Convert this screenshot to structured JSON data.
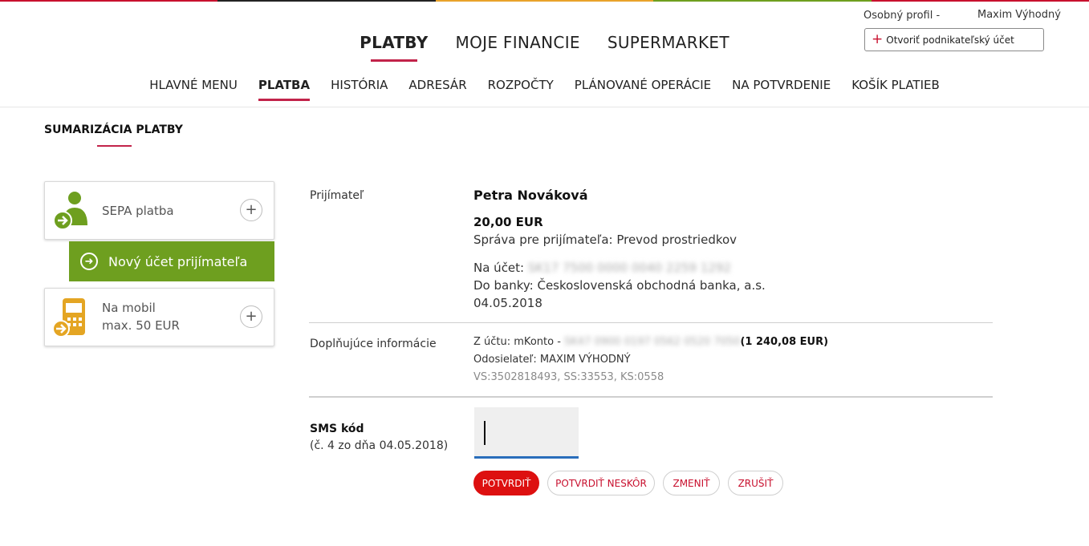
{
  "brand_colors": {
    "accent_red": "#c2234a",
    "action_red": "#dd1010",
    "green": "#6e9f1f",
    "input_focus_blue": "#2a6ebb"
  },
  "top_stripe_colors": [
    "#c8102e",
    "#222222",
    "#e9a32b",
    "#6e9f1f",
    "#c8102e"
  ],
  "header": {
    "profile_label": "Osobný profil  -",
    "user_name": "Maxim Výhodný",
    "open_business_label": "Otvoriť podnikateľský účet",
    "open_business_icon": "plus-icon"
  },
  "main_nav": [
    "PLATBY",
    "MOJE FINANCIE",
    "SUPERMARKET"
  ],
  "main_nav_active": "PLATBY",
  "sub_nav": [
    "HLAVNÉ MENU",
    "PLATBA",
    "HISTÓRIA",
    "ADRESÁR",
    "ROZPOČTY",
    "PLÁNOVANÉ OPERÁCIE",
    "NA POTVRDENIE",
    "KOŠÍK PLATIEB"
  ],
  "sub_nav_active": "PLATBA",
  "page_title": "SUMARIZÁCIA PLATBY",
  "sidebar": {
    "sepa": {
      "label": "SEPA platba",
      "icon": "person-arrow-icon",
      "expand": "+"
    },
    "new_payee": {
      "label": "Nový účet prijímateľa",
      "icon": "arrow-right-circle-icon"
    },
    "mobile": {
      "label_line1": "Na mobil",
      "label_line2": "max. 50 EUR",
      "icon": "phone-arrow-icon",
      "expand": "+"
    }
  },
  "summary": {
    "recipient_label": "Prijímateľ",
    "recipient_name": "Petra Nováková",
    "amount": "20,00 EUR",
    "message": "Správa pre prijímateľa: Prevod prostriedkov",
    "account_label": "Na účet:",
    "account_value": "SK17 7500 0000 0040 2259 1292",
    "bank": "Do banky: Československá obchodná banka, a.s.",
    "date": "04.05.2018"
  },
  "additional": {
    "label": "Doplňujúce informácie",
    "from_account_label": "Z účtu:  mKonto -",
    "from_account_value": "SK47 0900 0197 0562 0520 7050",
    "balance": "(1 240,08 EUR)",
    "sender": "Odosielateľ:  MAXIM VÝHODNÝ",
    "symbols": "VS:3502818493, SS:33553, KS:0558"
  },
  "sms": {
    "label": "SMS kód",
    "sub_label": "(č. 4 zo dňa 04.05.2018)",
    "value": ""
  },
  "buttons": {
    "confirm": "POTVRDIŤ",
    "confirm_later": "POTVRDIŤ NESKÔR",
    "change": "ZMENIŤ",
    "cancel": "ZRUŠIŤ"
  }
}
